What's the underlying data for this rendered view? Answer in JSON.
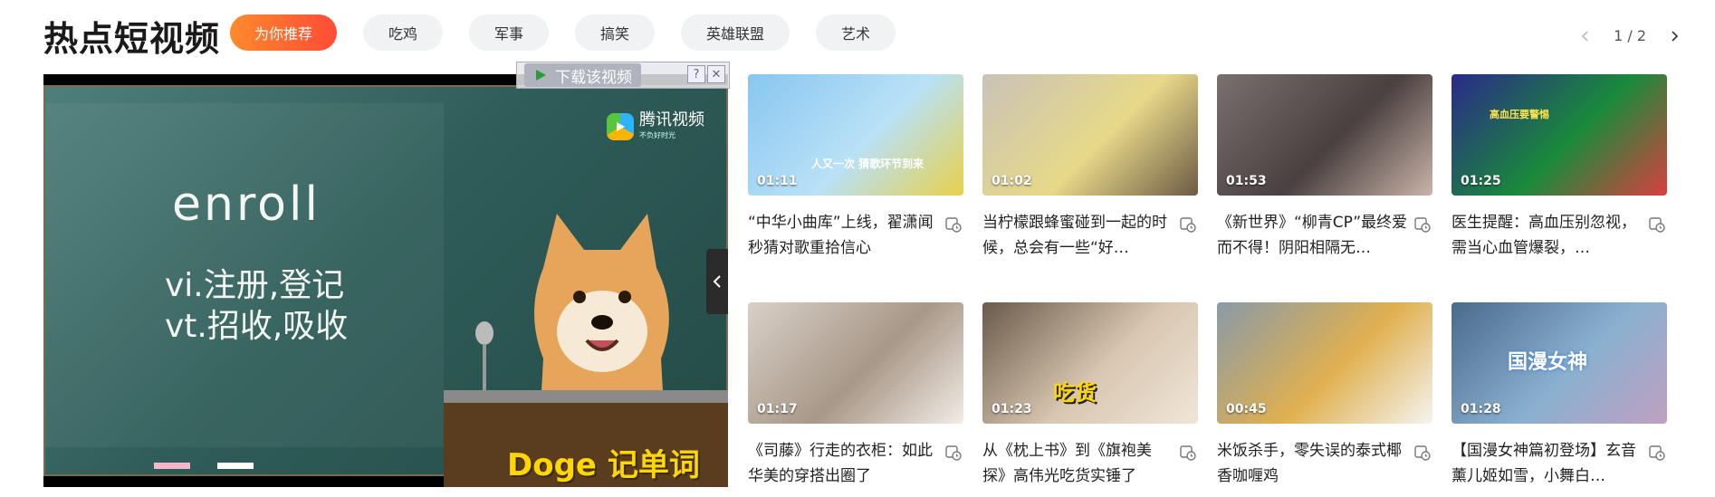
{
  "header": {
    "title": "热点短视频",
    "tabs": [
      {
        "label": "为你推荐",
        "active": true
      },
      {
        "label": "吃鸡",
        "active": false
      },
      {
        "label": "军事",
        "active": false
      },
      {
        "label": "搞笑",
        "active": false
      },
      {
        "label": "英雄联盟",
        "active": false
      },
      {
        "label": "艺术",
        "active": false
      }
    ],
    "pager": {
      "text": "1 / 2",
      "prev_icon": "chevron-left-icon",
      "next_icon": "chevron-right-icon"
    }
  },
  "featured": {
    "word": "enroll",
    "def1": "vi.注册,登记",
    "def2": "vt.招收,吸收",
    "brand": "腾讯视频",
    "brand_sub": "不负好时光",
    "series": "Doge 记单词",
    "download_label": "下载该视频",
    "help_label": "?",
    "close_label": "✕"
  },
  "videos": [
    {
      "duration": "01:11",
      "title": "“中华小曲库”上线，翟潇闻秒猜对歌重拾信心",
      "overlay": "人又一次 猜歌环节到来",
      "colors": [
        "#88c6f0",
        "#b9e1f7",
        "#e8d04a"
      ]
    },
    {
      "duration": "01:02",
      "title": "当柠檬跟蜂蜜碰到一起的时候，总会有一些“好…",
      "overlay": "",
      "colors": [
        "#c9c2b8",
        "#e7d989",
        "#6d5a45"
      ]
    },
    {
      "duration": "01:53",
      "title": "《新世界》“柳青CP”最终爱而不得！阴阳相隔无…",
      "overlay": "",
      "colors": [
        "#7a7070",
        "#4a4040",
        "#c9b4a8"
      ]
    },
    {
      "duration": "01:25",
      "title": "医生提醒：高血压别忽视，需当心血管爆裂，…",
      "overlay": "高血压要警惕",
      "colors": [
        "#2a2a8a",
        "#1a8a3a",
        "#d84040"
      ]
    },
    {
      "duration": "01:17",
      "title": "《司藤》行走的衣柜：如此华美的穿搭出圈了",
      "overlay": "",
      "colors": [
        "#d8d0c8",
        "#a89888",
        "#f2ece6"
      ]
    },
    {
      "duration": "01:23",
      "title": "从《枕上书》到《旗袍美探》高伟光吃货实锤了",
      "overlay": "吃货",
      "colors": [
        "#6a5a4a",
        "#d8c6b0",
        "#f0e6d8"
      ]
    },
    {
      "duration": "00:45",
      "title": "米饭杀手，零失误的泰式椰香咖喱鸡",
      "overlay": "",
      "colors": [
        "#8a9aa8",
        "#e0b050",
        "#f4f4f0"
      ]
    },
    {
      "duration": "01:28",
      "title": "【国漫女神篇初登场】玄音薰儿姬如雪，小舞白…",
      "overlay": "国漫女神",
      "colors": [
        "#4a6a8a",
        "#8ab0d0",
        "#c0a0c0"
      ]
    }
  ],
  "icons": {
    "save": "watch-later-icon",
    "collapse": "chevron-left-icon",
    "download": "play-triangle-icon"
  },
  "colors": {
    "accent_start": "#ff8a2b",
    "accent_end": "#ff4b36"
  }
}
